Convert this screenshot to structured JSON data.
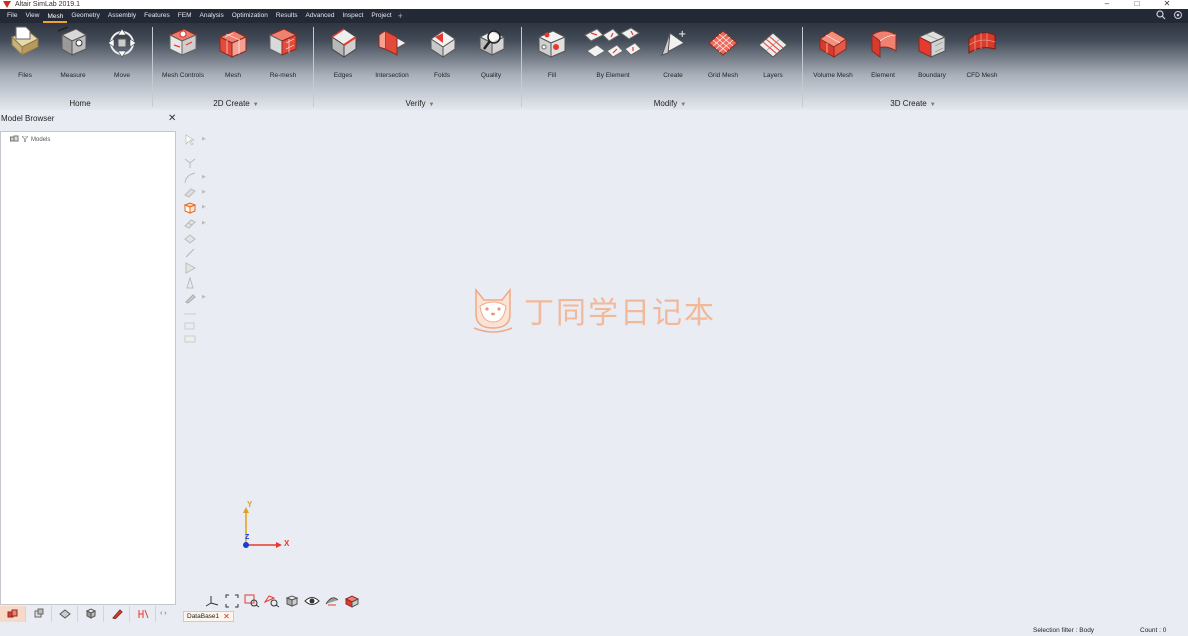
{
  "window": {
    "title": "Altair SimLab 2019.1",
    "controls": [
      "–",
      "□",
      "✕"
    ]
  },
  "menu": {
    "items": [
      "File",
      "View",
      "Mesh",
      "Geometry",
      "Assembly",
      "Features",
      "FEM",
      "Analysis",
      "Optimization",
      "Results",
      "Advanced",
      "Inspect",
      "Project"
    ],
    "active": "Mesh",
    "add": "+"
  },
  "ribbon": {
    "groups": [
      {
        "name": "Home",
        "has_dropdown": false,
        "tools": [
          "Files",
          "Measure",
          "Move"
        ]
      },
      {
        "name": "2D Create",
        "has_dropdown": true,
        "tools": [
          "Mesh Controls",
          "Mesh",
          "Re-mesh"
        ]
      },
      {
        "name": "Verify",
        "has_dropdown": true,
        "tools": [
          "Edges",
          "Intersection",
          "Folds",
          "Quality"
        ]
      },
      {
        "name": "Modify",
        "has_dropdown": true,
        "tools": [
          "Fill",
          "By Element",
          "Create",
          "Grid Mesh",
          "Layers"
        ]
      },
      {
        "name": "3D Create",
        "has_dropdown": true,
        "tools": [
          "Volume Mesh",
          "Element",
          "Boundary",
          "CFD Mesh"
        ]
      }
    ],
    "caret": "▼"
  },
  "model_browser": {
    "title": "Model Browser",
    "close": "✕",
    "tree": [
      {
        "label": "Models"
      }
    ]
  },
  "viewport": {
    "axes": {
      "x": "X",
      "y": "Y",
      "z": "Z"
    },
    "watermark_text": "丁同学日记本"
  },
  "bottom": {
    "nav": "‹ ›",
    "doc_tab": "DataBase1",
    "doc_tab_close": "✕"
  },
  "status": {
    "selection_filter": "Selection filter : Body",
    "count": "Count : 0"
  },
  "colors": {
    "accent": "#e8392f",
    "menubar": "#242a35",
    "viewport": "#e9edf3"
  }
}
